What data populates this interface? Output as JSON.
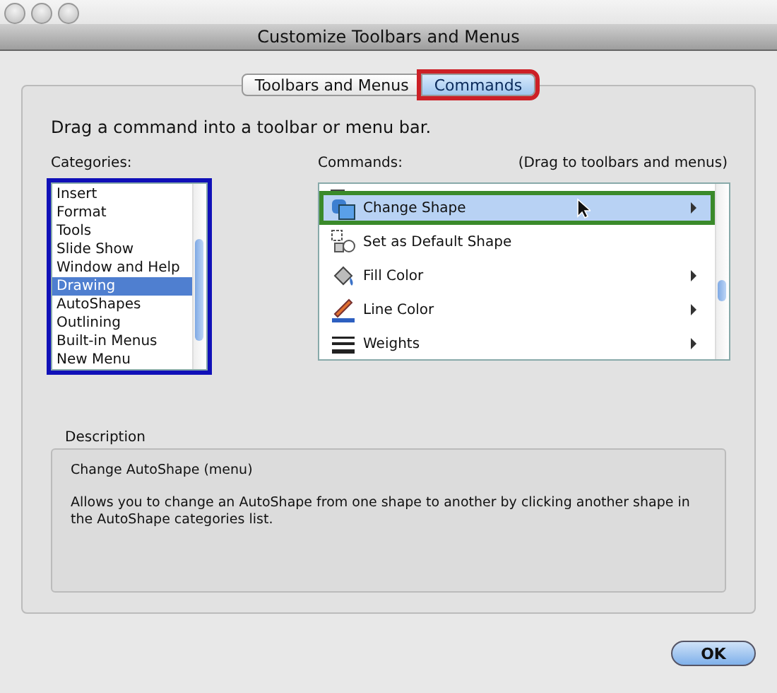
{
  "window": {
    "title": "Customize Toolbars and Menus"
  },
  "tabs": [
    {
      "label": "Toolbars and Menus",
      "selected": false,
      "highlighted": false
    },
    {
      "label": "Commands",
      "selected": true,
      "highlighted": true
    }
  ],
  "instruction": "Drag a command into a toolbar or menu bar.",
  "categories": {
    "label": "Categories:",
    "highlighted": true,
    "items": [
      {
        "label": "Insert",
        "selected": false
      },
      {
        "label": "Format",
        "selected": false
      },
      {
        "label": "Tools",
        "selected": false
      },
      {
        "label": "Slide Show",
        "selected": false
      },
      {
        "label": "Window and Help",
        "selected": false
      },
      {
        "label": "Drawing",
        "selected": true
      },
      {
        "label": "AutoShapes",
        "selected": false
      },
      {
        "label": "Outlining",
        "selected": false
      },
      {
        "label": "Built-in Menus",
        "selected": false
      },
      {
        "label": "New Menu",
        "selected": false
      }
    ]
  },
  "commands": {
    "label": "Commands:",
    "hint": "(Drag to toolbars and menus)",
    "items": [
      {
        "label": "Change Shape",
        "selected": true,
        "submenu": true,
        "highlighted": true
      },
      {
        "label": "Set as Default Shape",
        "selected": false,
        "submenu": false,
        "highlighted": false
      },
      {
        "label": "Fill Color",
        "selected": false,
        "submenu": true,
        "highlighted": false
      },
      {
        "label": "Line Color",
        "selected": false,
        "submenu": true,
        "highlighted": false
      },
      {
        "label": "Weights",
        "selected": false,
        "submenu": true,
        "highlighted": false
      }
    ]
  },
  "description": {
    "label": "Description",
    "title": "Change AutoShape (menu)",
    "text": "Allows you to change an AutoShape from one shape to another by clicking another shape in the AutoShape categories list."
  },
  "buttons": [
    {
      "label": "OK"
    }
  ]
}
